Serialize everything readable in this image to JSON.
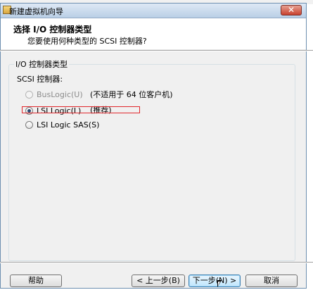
{
  "window": {
    "title": "新建虚拟机向导",
    "close_glyph": "✕"
  },
  "header": {
    "title": "选择 I/O 控制器类型",
    "subtitle": "您要使用何种类型的 SCSI 控制器?"
  },
  "group": {
    "legend": "I/O 控制器类型",
    "scsi_label": "SCSI 控制器:",
    "options": [
      {
        "label": "BusLogic(U)",
        "note": "(不适用于 64 位客户机)",
        "selected": false,
        "enabled": false
      },
      {
        "label": "LSI Logic(L)",
        "note": "(推荐)",
        "selected": true,
        "enabled": true
      },
      {
        "label": "LSI Logic SAS(S)",
        "note": "",
        "selected": false,
        "enabled": true
      }
    ]
  },
  "buttons": {
    "help": "帮助",
    "back": "< 上一步(B)",
    "next": "下一步(N) >",
    "cancel": "取消"
  },
  "colors": {
    "highlight": "#e0262b",
    "title_gradient_top": "#dfe9f5",
    "close_red": "#c8422f"
  }
}
